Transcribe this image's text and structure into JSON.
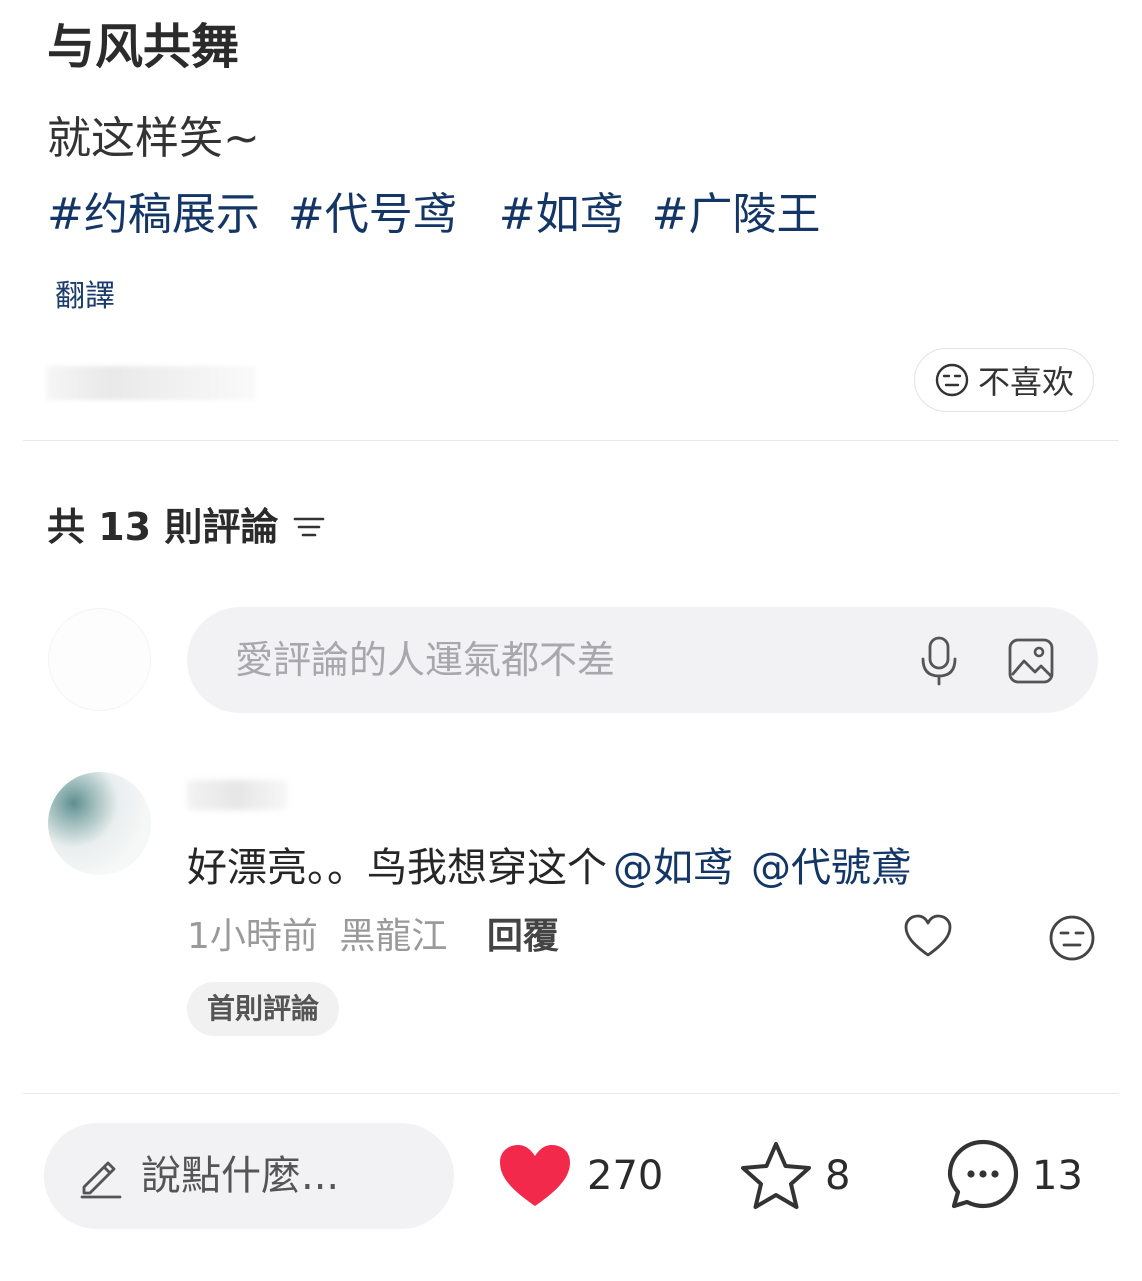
{
  "post": {
    "title": "与风共舞",
    "body": "就这样笑~",
    "hashtags": [
      "#约稿展示",
      "#代号鸢",
      "#如鸢",
      "#广陵王"
    ],
    "translate": "翻譯",
    "dislike_label": "不喜欢"
  },
  "comments": {
    "count_label": "共 13 則評論",
    "input_placeholder": "愛評論的人運氣都不差",
    "items": [
      {
        "text": "好漂亮。。鸟我想穿这个",
        "mentions": [
          "@如鸢",
          "@代號鳶"
        ],
        "time": "1小時前",
        "location": "黑龍江",
        "reply_label": "回覆",
        "badge": "首則評論"
      }
    ]
  },
  "bottom_bar": {
    "say_placeholder": "說點什麼...",
    "likes": "270",
    "favorites": "8",
    "comments": "13"
  },
  "colors": {
    "hashtag": "#133667",
    "like_heart": "#f2294a",
    "input_bg": "#f2f2f4"
  }
}
